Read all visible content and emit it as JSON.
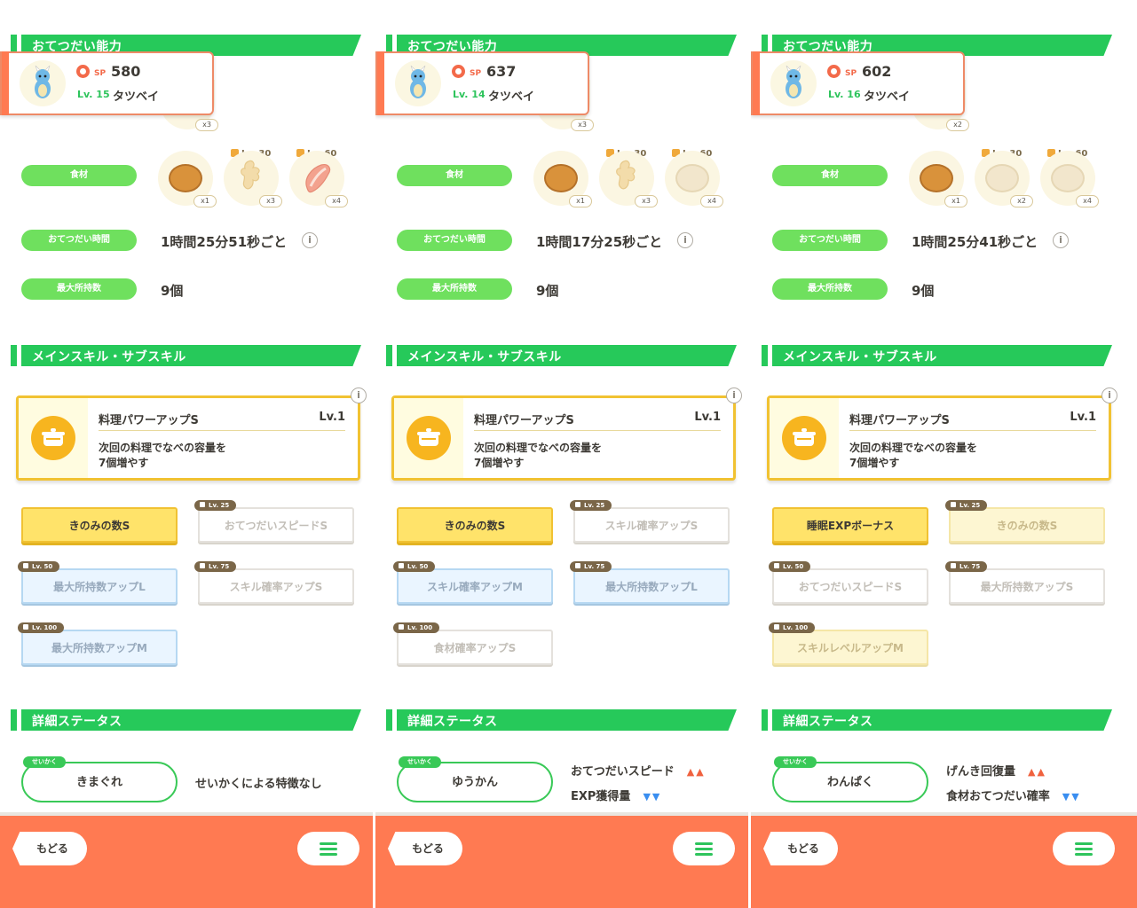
{
  "sections": {
    "helper": "おてつだい能力",
    "skills": "メインスキル・サブスキル",
    "status": "詳細ステータス"
  },
  "labels": {
    "ingredient": "食材",
    "help_time": "おてつだい時間",
    "max_carry": "最大所持数",
    "nature_tag": "せいかく",
    "back": "もどる"
  },
  "colors": {
    "accent_green": "#26c95a",
    "bottom_bar": "#ff7a52",
    "gold": "#f1c232"
  },
  "panels": [
    {
      "sp_label": "SP",
      "sp": "580",
      "level": "Lv. 15",
      "name": "タツベイ",
      "berry_count": "x3",
      "ingredients": [
        {
          "icon": "potato-icon",
          "count": "x1",
          "unlock": ""
        },
        {
          "icon": "ginger-icon",
          "count": "x3",
          "unlock": "Lv. 30"
        },
        {
          "icon": "bacon-icon",
          "count": "x4",
          "unlock": "Lv. 60"
        }
      ],
      "help_time": "1時間25分51秒ごと",
      "max_carry": "9個",
      "main_skill": {
        "name": "料理パワーアップS",
        "level": "Lv.1",
        "desc": "次回の料理でなべの容量を\n7個増やす"
      },
      "sub_skills": [
        {
          "label": "きのみの数S",
          "unlock": "",
          "style": "gold"
        },
        {
          "label": "おてつだいスピードS",
          "unlock": "Lv. 25",
          "style": "white"
        },
        {
          "label": "最大所持数アップL",
          "unlock": "Lv. 50",
          "style": "blue"
        },
        {
          "label": "スキル確率アップS",
          "unlock": "Lv. 75",
          "style": "white"
        },
        {
          "label": "最大所持数アップM",
          "unlock": "Lv. 100",
          "style": "blue"
        }
      ],
      "nature": "きまぐれ",
      "nature_effect": "せいかくによる特徴なし"
    },
    {
      "sp_label": "SP",
      "sp": "637",
      "level": "Lv. 14",
      "name": "タツベイ",
      "berry_count": "x3",
      "ingredients": [
        {
          "icon": "potato-icon",
          "count": "x1",
          "unlock": ""
        },
        {
          "icon": "ginger-icon",
          "count": "x3",
          "unlock": "Lv. 30"
        },
        {
          "icon": "potato-locked-icon",
          "count": "x4",
          "unlock": "Lv. 60"
        }
      ],
      "help_time": "1時間17分25秒ごと",
      "max_carry": "9個",
      "main_skill": {
        "name": "料理パワーアップS",
        "level": "Lv.1",
        "desc": "次回の料理でなべの容量を\n7個増やす"
      },
      "sub_skills": [
        {
          "label": "きのみの数S",
          "unlock": "",
          "style": "gold"
        },
        {
          "label": "スキル確率アップS",
          "unlock": "Lv. 25",
          "style": "white"
        },
        {
          "label": "スキル確率アップM",
          "unlock": "Lv. 50",
          "style": "blue"
        },
        {
          "label": "最大所持数アップL",
          "unlock": "Lv. 75",
          "style": "blue"
        },
        {
          "label": "食材確率アップS",
          "unlock": "Lv. 100",
          "style": "white"
        }
      ],
      "nature": "ゆうかん",
      "nature_up": "おてつだいスピード",
      "nature_down": "EXP獲得量",
      "up_mark": "▲▲",
      "down_mark": "▼▼"
    },
    {
      "sp_label": "SP",
      "sp": "602",
      "level": "Lv. 16",
      "name": "タツベイ",
      "berry_count": "x2",
      "ingredients": [
        {
          "icon": "potato-icon",
          "count": "x1",
          "unlock": ""
        },
        {
          "icon": "potato-locked-icon",
          "count": "x2",
          "unlock": "Lv. 30"
        },
        {
          "icon": "potato-locked-icon",
          "count": "x4",
          "unlock": "Lv. 60"
        }
      ],
      "help_time": "1時間25分41秒ごと",
      "max_carry": "9個",
      "main_skill": {
        "name": "料理パワーアップS",
        "level": "Lv.1",
        "desc": "次回の料理でなべの容量を\n7個増やす"
      },
      "sub_skills": [
        {
          "label": "睡眠EXPボーナス",
          "unlock": "",
          "style": "gold"
        },
        {
          "label": "きのみの数S",
          "unlock": "Lv. 25",
          "style": "gold-lock"
        },
        {
          "label": "おてつだいスピードS",
          "unlock": "Lv. 50",
          "style": "white"
        },
        {
          "label": "最大所持数アップS",
          "unlock": "Lv. 75",
          "style": "white"
        },
        {
          "label": "スキルレベルアップM",
          "unlock": "Lv. 100",
          "style": "gold-lock"
        }
      ],
      "nature": "わんぱく",
      "nature_up": "げんき回復量",
      "nature_down": "食材おてつだい確率",
      "up_mark": "▲▲",
      "down_mark": "▼▼"
    }
  ]
}
